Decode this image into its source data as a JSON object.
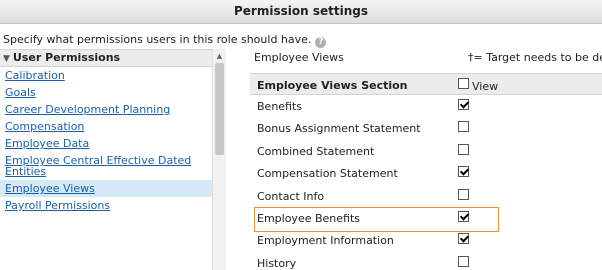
{
  "window": {
    "title": "Permission settings"
  },
  "instructions": "Specify what permissions users in this role should have.",
  "left_panel": {
    "group_label": "User Permissions",
    "items": [
      {
        "label": "Calibration",
        "selected": false
      },
      {
        "label": "Goals",
        "selected": false
      },
      {
        "label": "Career Development Planning",
        "selected": false
      },
      {
        "label": "Compensation",
        "selected": false
      },
      {
        "label": "Employee Data",
        "selected": false
      },
      {
        "label": "Employee Central Effective Dated Entities",
        "selected": false
      },
      {
        "label": "Employee Views",
        "selected": true
      },
      {
        "label": "Payroll Permissions",
        "selected": false
      }
    ]
  },
  "right_panel": {
    "heading": "Employee Views",
    "note": "†= Target needs to be define",
    "section": {
      "title": "Employee Views Section",
      "view_label": "View",
      "view_checked": false
    },
    "rows": [
      {
        "label": "Benefits",
        "checked": true,
        "highlighted": false
      },
      {
        "label": "Bonus Assignment Statement",
        "checked": false,
        "highlighted": false
      },
      {
        "label": "Combined Statement",
        "checked": false,
        "highlighted": false
      },
      {
        "label": "Compensation Statement",
        "checked": true,
        "highlighted": false
      },
      {
        "label": "Contact Info",
        "checked": false,
        "highlighted": false
      },
      {
        "label": "Employee Benefits",
        "checked": true,
        "highlighted": true
      },
      {
        "label": "Employment Information",
        "checked": true,
        "highlighted": false
      },
      {
        "label": "History",
        "checked": false,
        "highlighted": false
      }
    ]
  },
  "icons": {
    "help": "help-icon",
    "collapse": "triangle-down-icon",
    "scroll_up": "scroll-up-arrow-icon"
  },
  "colors": {
    "link": "#1a5fa8",
    "selected_row": "#d5e9f7",
    "highlight_border": "#f0913a"
  }
}
